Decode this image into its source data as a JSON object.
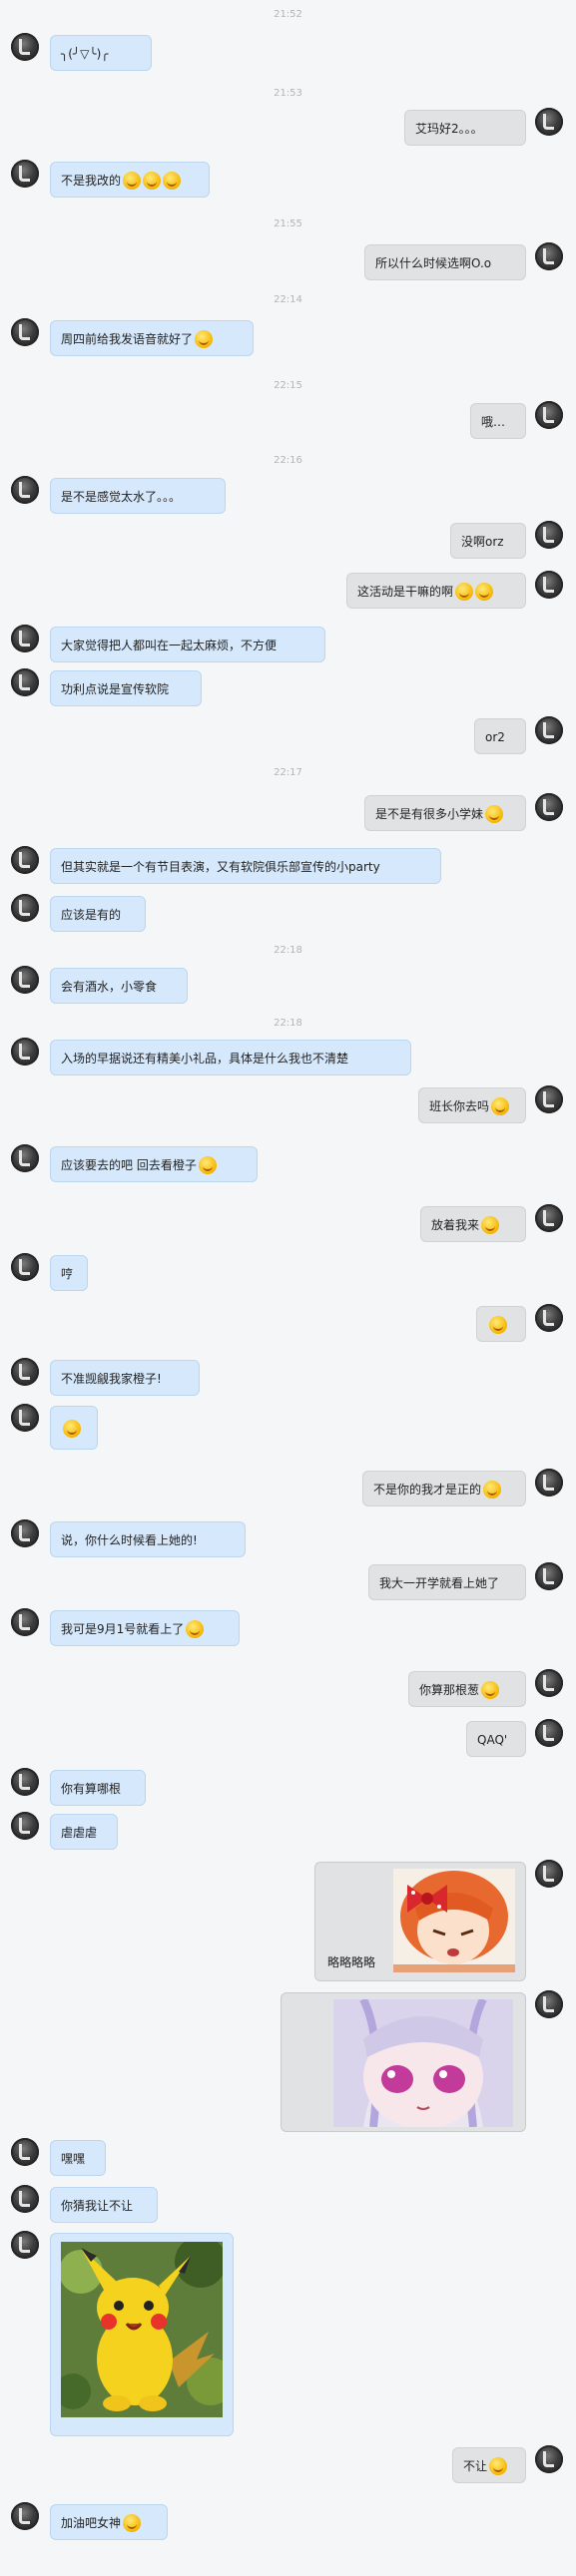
{
  "conversation": {
    "times": [
      "21:52",
      "21:53",
      "21:55",
      "22:14",
      "22:15",
      "22:16",
      "22:17",
      "22:18",
      "22:18"
    ],
    "messages": [
      {
        "side": "left",
        "text": "╮(╯▽╰)╭",
        "emoji": 0
      },
      {
        "side": "right",
        "text": "艾玛好2。。。",
        "emoji": 0
      },
      {
        "side": "left",
        "text": "不是我改的",
        "emoji": 3
      },
      {
        "side": "right",
        "text": "所以什么时候选啊O.o",
        "emoji": 0
      },
      {
        "side": "left",
        "text": "周四前给我发语音就好了",
        "emoji": 1
      },
      {
        "side": "right",
        "text": "哦…",
        "emoji": 0
      },
      {
        "side": "left",
        "text": "是不是感觉太水了。。。",
        "emoji": 0
      },
      {
        "side": "right",
        "text": "没啊orz",
        "emoji": 0
      },
      {
        "side": "right",
        "text": "这活动是干嘛的啊",
        "emoji": 2
      },
      {
        "side": "left",
        "text": "大家觉得把人都叫在一起太麻烦，不方便",
        "emoji": 0
      },
      {
        "side": "left",
        "text": "功利点说是宣传软院",
        "emoji": 0
      },
      {
        "side": "right",
        "text": "or2",
        "emoji": 0
      },
      {
        "side": "right",
        "text": "是不是有很多小学妹",
        "emoji": 1
      },
      {
        "side": "left",
        "text": "但其实就是一个有节目表演，又有软院俱乐部宣传的小party",
        "emoji": 0
      },
      {
        "side": "left",
        "text": "应该是有的",
        "emoji": 0
      },
      {
        "side": "left",
        "text": "会有酒水，小零食",
        "emoji": 0
      },
      {
        "side": "left",
        "text": "入场的早据说还有精美小礼品，具体是什么我也不清楚",
        "emoji": 0
      },
      {
        "side": "right",
        "text": "班长你去吗",
        "emoji": 1
      },
      {
        "side": "left",
        "text": "应该要去的吧  回去看橙子",
        "emoji": 1
      },
      {
        "side": "right",
        "text": "放着我来",
        "emoji": 1
      },
      {
        "side": "left",
        "text": "哼",
        "emoji": 0
      },
      {
        "side": "right",
        "text": "",
        "emoji": 1
      },
      {
        "side": "left",
        "text": "不准觊觎我家橙子!",
        "emoji": 0
      },
      {
        "side": "left",
        "text": "",
        "emoji": 1
      },
      {
        "side": "right",
        "text": "不是你的我才是正的",
        "emoji": 1
      },
      {
        "side": "left",
        "text": "说，你什么时候看上她的!",
        "emoji": 0
      },
      {
        "side": "right",
        "text": "我大一开学就看上她了",
        "emoji": 0
      },
      {
        "side": "left",
        "text": "我可是9月1号就看上了",
        "emoji": 1
      },
      {
        "side": "right",
        "text": "你算那根葱",
        "emoji": 1
      },
      {
        "side": "right",
        "text": "QAQ'",
        "emoji": 0
      },
      {
        "side": "left",
        "text": "你有算哪根",
        "emoji": 0
      },
      {
        "side": "left",
        "text": "虐虐虐",
        "emoji": 0
      },
      {
        "side": "right",
        "text": "略略略略",
        "emoji": 0,
        "image": "anime-girl-orange-hair"
      },
      {
        "side": "right",
        "text": "",
        "emoji": 0,
        "image": "anime-girl-white-hair"
      },
      {
        "side": "left",
        "text": "嘿嘿",
        "emoji": 0
      },
      {
        "side": "left",
        "text": "你猜我让不让",
        "emoji": 0
      },
      {
        "side": "left",
        "text": "",
        "emoji": 0,
        "image": "pikachu"
      },
      {
        "side": "right",
        "text": "不让",
        "emoji": 1
      },
      {
        "side": "left",
        "text": "加油吧女神",
        "emoji": 1
      }
    ]
  },
  "colors": {
    "left_bubble": "#d6e8fb",
    "right_bubble": "#e1e2e4",
    "background": "#f5f6f7",
    "timestamp": "#b4b4b4"
  }
}
